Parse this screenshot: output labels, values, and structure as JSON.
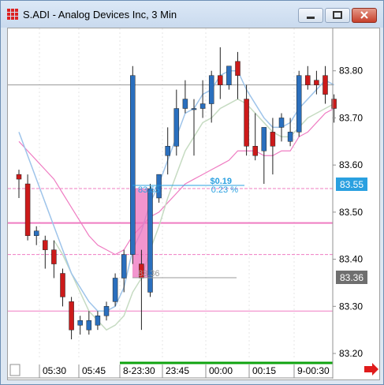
{
  "window": {
    "title": "S.ADI - Analog Devices Inc, 3 Min",
    "buttons": {
      "minimize": "minimize",
      "maximize": "maximize",
      "close": "close"
    }
  },
  "price_axis": {
    "ticks": [
      "83.80",
      "83.70",
      "83.60",
      "83.50",
      "83.40",
      "83.30",
      "83.20"
    ],
    "flag_upper": "83.55",
    "flag_lower": "83.36"
  },
  "time_axis": {
    "ticks": [
      "05:30",
      "05:45",
      "8-23:30",
      "23:45",
      "00:00",
      "00:15",
      "9-00:30"
    ]
  },
  "measure": {
    "delta": "$0.19",
    "percent": "0.23 %",
    "start_label": "83.55",
    "end_label": "83.36"
  },
  "chart_data": {
    "type": "candlestick",
    "symbol": "S.ADI",
    "interval": "3 Min",
    "ylim": [
      83.19,
      83.89
    ],
    "colors": {
      "up": "#2a6fbe",
      "down": "#cc1a1a",
      "ma_fast": "#9ec4ea",
      "ma_slow": "#c6dbc2",
      "band": "#ef7cc2",
      "measure": "#2aa0e0"
    },
    "candles": [
      [
        83.58,
        83.59,
        83.53,
        83.57
      ],
      [
        83.56,
        83.58,
        83.44,
        83.45
      ],
      [
        83.45,
        83.47,
        83.43,
        83.46
      ],
      [
        83.44,
        83.45,
        83.38,
        83.42
      ],
      [
        83.42,
        83.44,
        83.36,
        83.39
      ],
      [
        83.37,
        83.38,
        83.3,
        83.32
      ],
      [
        83.31,
        83.32,
        83.23,
        83.25
      ],
      [
        83.26,
        83.28,
        83.24,
        83.27
      ],
      [
        83.25,
        83.29,
        83.24,
        83.27
      ],
      [
        83.26,
        83.29,
        83.25,
        83.28
      ],
      [
        83.28,
        83.31,
        83.27,
        83.3
      ],
      [
        83.31,
        83.37,
        83.3,
        83.36
      ],
      [
        83.36,
        83.42,
        83.33,
        83.41
      ],
      [
        83.41,
        83.81,
        83.39,
        83.79
      ],
      [
        83.39,
        83.42,
        83.25,
        83.36
      ],
      [
        83.33,
        83.56,
        83.32,
        83.55
      ],
      [
        83.53,
        83.58,
        83.52,
        83.58
      ],
      [
        83.62,
        83.68,
        83.58,
        83.64
      ],
      [
        83.64,
        83.76,
        83.62,
        83.72
      ],
      [
        83.72,
        83.78,
        83.71,
        83.74
      ],
      [
        83.72,
        83.74,
        83.62,
        83.72
      ],
      [
        83.72,
        83.78,
        83.7,
        83.73
      ],
      [
        83.73,
        83.8,
        83.69,
        83.79
      ],
      [
        83.79,
        83.85,
        83.74,
        83.77
      ],
      [
        83.77,
        83.81,
        83.76,
        83.81
      ],
      [
        83.82,
        83.84,
        83.74,
        83.79
      ],
      [
        83.74,
        83.77,
        83.62,
        83.64
      ],
      [
        83.64,
        83.71,
        83.61,
        83.62
      ],
      [
        83.63,
        83.67,
        83.56,
        83.68
      ],
      [
        83.67,
        83.7,
        83.58,
        83.64
      ],
      [
        83.68,
        83.71,
        83.65,
        83.7
      ],
      [
        83.65,
        83.7,
        83.64,
        83.67
      ],
      [
        83.67,
        83.8,
        83.66,
        83.79
      ],
      [
        83.79,
        83.81,
        83.76,
        83.77
      ],
      [
        83.78,
        83.8,
        83.75,
        83.77
      ],
      [
        83.79,
        83.81,
        83.73,
        83.75
      ],
      [
        83.74,
        83.75,
        83.69,
        83.72
      ]
    ],
    "ma_fast": [
      83.67,
      83.62,
      83.57,
      83.52,
      83.47,
      83.42,
      83.37,
      83.34,
      83.31,
      83.29,
      83.29,
      83.3,
      83.34,
      83.42,
      83.46,
      83.52,
      83.56,
      83.61,
      83.66,
      83.71,
      83.72,
      83.75,
      83.76,
      83.79,
      83.8,
      83.8,
      83.76,
      83.73,
      83.7,
      83.68,
      83.68,
      83.69,
      83.72,
      83.74,
      83.76,
      83.78,
      83.77
    ],
    "ma_slow": [
      null,
      null,
      null,
      null,
      83.44,
      83.41,
      83.37,
      83.33,
      83.29,
      83.27,
      83.25,
      83.26,
      83.28,
      83.33,
      83.36,
      83.42,
      83.47,
      83.53,
      83.58,
      83.63,
      83.66,
      83.69,
      83.7,
      83.72,
      83.73,
      83.74,
      83.73,
      83.71,
      83.69,
      83.67,
      83.66,
      83.66,
      83.68,
      83.7,
      83.71,
      83.72,
      83.73
    ],
    "band_upper": [
      83.65,
      83.63,
      83.61,
      83.59,
      83.57,
      83.54,
      83.51,
      83.48,
      83.45,
      83.43,
      83.42,
      83.41,
      83.42,
      83.45,
      83.47,
      83.49,
      83.5,
      83.52,
      83.54,
      83.56,
      83.57,
      83.58,
      83.59,
      83.6,
      83.61,
      83.63,
      83.63,
      83.63,
      83.62,
      83.62,
      83.63,
      83.63,
      83.66,
      83.67,
      83.69,
      83.71,
      83.72
    ],
    "levels": [
      {
        "price": 83.77,
        "color": "#999999"
      },
      {
        "price": 83.55,
        "color": "#ef7cc2"
      },
      {
        "price": 83.477,
        "color": "#ef7cc2"
      },
      {
        "price": 83.41,
        "color": "#ef7cc2"
      },
      {
        "price": 83.29,
        "color": "#ef7cc2"
      }
    ],
    "measure": {
      "from": 83.55,
      "to": 83.36,
      "delta": 0.19,
      "percent": 0.23
    }
  }
}
